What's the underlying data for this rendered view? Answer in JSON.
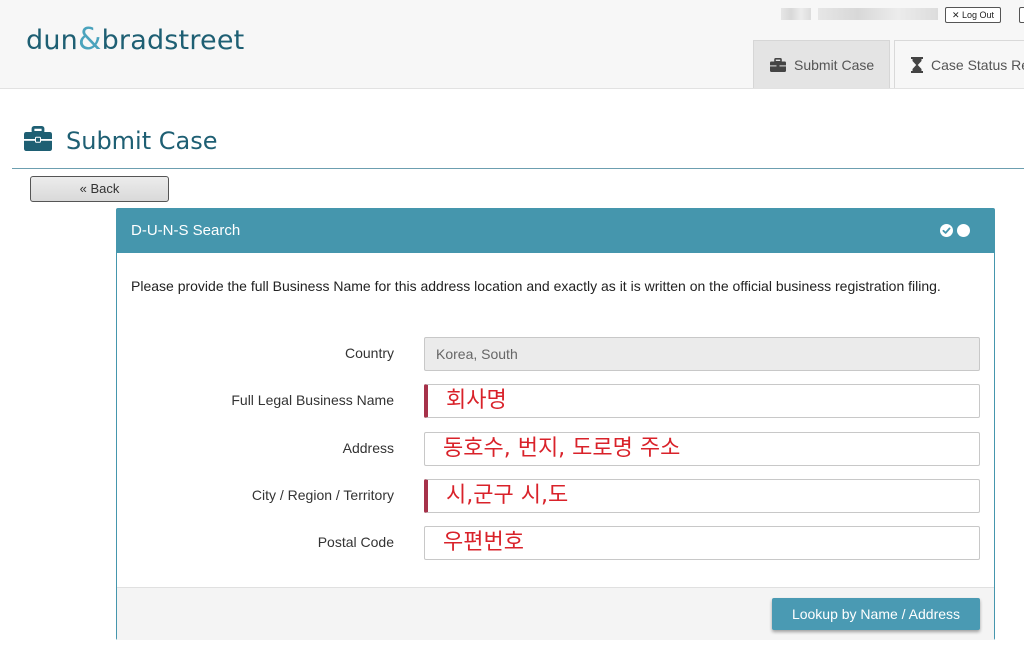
{
  "brand": {
    "logo_left": "dun",
    "logo_amp": "&",
    "logo_right": "bradstreet"
  },
  "header": {
    "logout_label": "Log Out",
    "logout_icon": "close-x",
    "tabs": [
      {
        "label": "Submit Case",
        "icon": "briefcase-icon",
        "active": true
      },
      {
        "label": "Case Status Re",
        "icon": "hourglass-icon",
        "active": false
      }
    ]
  },
  "page": {
    "title": "Submit Case",
    "title_icon": "briefcase-icon",
    "back_label": "« Back"
  },
  "panel": {
    "title": "D-U-N-S Search",
    "step_icons": [
      "check-dot-icon",
      "dot-icon"
    ],
    "instructions": "Please provide the full Business Name for this address location and exactly as it is written on the official business registration filing.",
    "fields": [
      {
        "label": "Country",
        "value": "Korea, South",
        "disabled": true,
        "required": false
      },
      {
        "label": "Full Legal Business Name",
        "value": "회사명",
        "disabled": false,
        "required": true
      },
      {
        "label": "Address",
        "value": "동호수, 번지, 도로명 주소",
        "disabled": false,
        "required": false
      },
      {
        "label": "City / Region / Territory",
        "value": "시,군구  시,도",
        "disabled": false,
        "required": true
      },
      {
        "label": "Postal Code",
        "value": "우편번호",
        "disabled": false,
        "required": false
      }
    ],
    "lookup_label": "Lookup by Name / Address"
  },
  "colors": {
    "brand": "#1e5f73",
    "accent": "#4596ad",
    "entered_text": "#d9222a",
    "required_marker": "#a6324a"
  }
}
